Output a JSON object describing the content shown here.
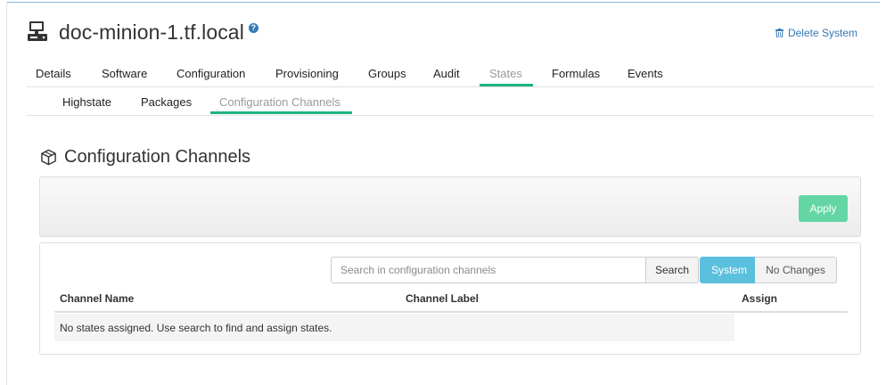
{
  "system": {
    "title": "doc-minion-1.tf.local",
    "help_icon": "?",
    "delete_label": "Delete System"
  },
  "tabs": [
    {
      "label": "Details"
    },
    {
      "label": "Software"
    },
    {
      "label": "Configuration"
    },
    {
      "label": "Provisioning"
    },
    {
      "label": "Groups"
    },
    {
      "label": "Audit"
    },
    {
      "label": "States",
      "active": true
    },
    {
      "label": "Formulas"
    },
    {
      "label": "Events"
    }
  ],
  "subtabs": [
    {
      "label": "Highstate"
    },
    {
      "label": "Packages"
    },
    {
      "label": "Configuration Channels",
      "active": true
    }
  ],
  "section": {
    "title": "Configuration Channels"
  },
  "toolbar": {
    "apply_label": "Apply"
  },
  "search": {
    "placeholder": "Search in configuration channels",
    "value": "",
    "button_label": "Search"
  },
  "filters": {
    "system_label": "System",
    "no_changes_label": "No Changes",
    "selected": "System"
  },
  "table": {
    "columns": [
      "Channel Name",
      "Channel Label",
      "Assign"
    ],
    "empty_message": "No states assigned. Use search to find and assign states."
  },
  "colors": {
    "accent_green": "#1eb57f",
    "apply_button": "#64d6a5",
    "filter_active": "#5bc0de",
    "link_blue": "#337ab7"
  },
  "icons": {
    "system": "server-computer-icon",
    "help": "question-circle-icon",
    "delete": "trash-icon",
    "section": "cube-icon"
  }
}
